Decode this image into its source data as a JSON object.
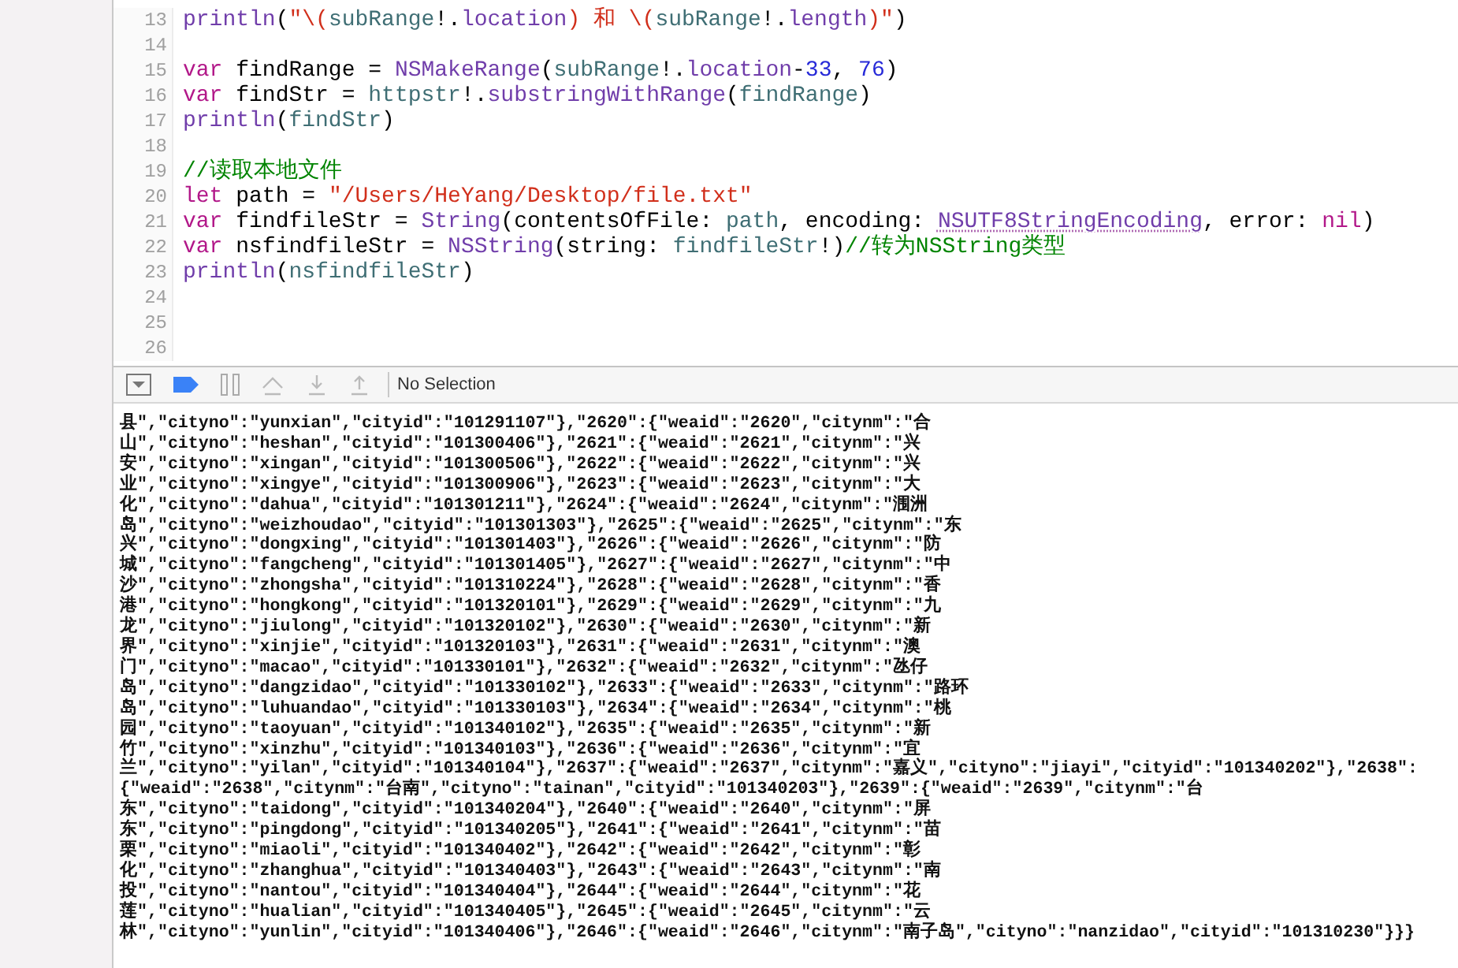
{
  "editor": {
    "lines": [
      {
        "number": "13",
        "tokens": [
          {
            "text": "println",
            "kind": "type"
          },
          {
            "text": "(",
            "kind": "plain"
          },
          {
            "text": "\"\\(",
            "kind": "string"
          },
          {
            "text": "subRange",
            "kind": "variable"
          },
          {
            "text": "!.",
            "kind": "plain"
          },
          {
            "text": "location",
            "kind": "type"
          },
          {
            "text": ") 和 \\(",
            "kind": "string"
          },
          {
            "text": "subRange",
            "kind": "variable"
          },
          {
            "text": "!.",
            "kind": "plain"
          },
          {
            "text": "length",
            "kind": "type"
          },
          {
            "text": ")\"",
            "kind": "string"
          },
          {
            "text": ")",
            "kind": "plain"
          }
        ]
      },
      {
        "number": "14"
      },
      {
        "number": "15",
        "tokens": [
          {
            "text": "var",
            "kind": "keyword"
          },
          {
            "text": " findRange = ",
            "kind": "plain"
          },
          {
            "text": "NSMakeRange",
            "kind": "type"
          },
          {
            "text": "(",
            "kind": "plain"
          },
          {
            "text": "subRange",
            "kind": "variable"
          },
          {
            "text": "!.",
            "kind": "plain"
          },
          {
            "text": "location",
            "kind": "type"
          },
          {
            "text": "-",
            "kind": "plain"
          },
          {
            "text": "33",
            "kind": "number"
          },
          {
            "text": ", ",
            "kind": "plain"
          },
          {
            "text": "76",
            "kind": "number"
          },
          {
            "text": ")",
            "kind": "plain"
          }
        ]
      },
      {
        "number": "16",
        "tokens": [
          {
            "text": "var",
            "kind": "keyword"
          },
          {
            "text": " findStr = ",
            "kind": "plain"
          },
          {
            "text": "httpstr",
            "kind": "variable"
          },
          {
            "text": "!.",
            "kind": "plain"
          },
          {
            "text": "substringWithRange",
            "kind": "type"
          },
          {
            "text": "(",
            "kind": "plain"
          },
          {
            "text": "findRange",
            "kind": "variable"
          },
          {
            "text": ")",
            "kind": "plain"
          }
        ]
      },
      {
        "number": "17",
        "tokens": [
          {
            "text": "println",
            "kind": "type"
          },
          {
            "text": "(",
            "kind": "plain"
          },
          {
            "text": "findStr",
            "kind": "variable"
          },
          {
            "text": ")",
            "kind": "plain"
          }
        ]
      },
      {
        "number": "18"
      },
      {
        "number": "19",
        "tokens": [
          {
            "text": "//读取本地文件",
            "kind": "comment"
          }
        ]
      },
      {
        "number": "20",
        "tokens": [
          {
            "text": "let",
            "kind": "keyword"
          },
          {
            "text": " path = ",
            "kind": "plain"
          },
          {
            "text": "\"/Users/HeYang/Desktop/file.txt\"",
            "kind": "string"
          }
        ]
      },
      {
        "number": "21",
        "tokens": [
          {
            "text": "var",
            "kind": "keyword"
          },
          {
            "text": " findfileStr = ",
            "kind": "plain"
          },
          {
            "text": "String",
            "kind": "type"
          },
          {
            "text": "(contentsOfFile: ",
            "kind": "plain"
          },
          {
            "text": "path",
            "kind": "variable"
          },
          {
            "text": ", encoding: ",
            "kind": "plain"
          },
          {
            "text": "NSUTF8StringEncoding",
            "kind": "flagged"
          },
          {
            "text": ", error: ",
            "kind": "plain"
          },
          {
            "text": "nil",
            "kind": "keyword"
          },
          {
            "text": ")",
            "kind": "plain"
          }
        ]
      },
      {
        "number": "22",
        "tokens": [
          {
            "text": "var",
            "kind": "keyword"
          },
          {
            "text": " nsfindfileStr = ",
            "kind": "plain"
          },
          {
            "text": "NSString",
            "kind": "type"
          },
          {
            "text": "(string: ",
            "kind": "plain"
          },
          {
            "text": "findfileStr",
            "kind": "variable"
          },
          {
            "text": "!)",
            "kind": "plain"
          },
          {
            "text": "//转为NSString类型",
            "kind": "comment"
          }
        ]
      },
      {
        "number": "23",
        "tokens": [
          {
            "text": "println",
            "kind": "type"
          },
          {
            "text": "(",
            "kind": "plain"
          },
          {
            "text": "nsfindfileStr",
            "kind": "variable"
          },
          {
            "text": ")",
            "kind": "plain"
          }
        ]
      },
      {
        "number": "24"
      },
      {
        "number": "25"
      },
      {
        "number": "26"
      }
    ]
  },
  "debug_bar": {
    "breakpoints_active": true,
    "selection_label": "No Selection"
  },
  "console": {
    "lines": [
      "县\",\"cityno\":\"yunxian\",\"cityid\":\"101291107\"},\"2620\":{\"weaid\":\"2620\",\"citynm\":\"合",
      "山\",\"cityno\":\"heshan\",\"cityid\":\"101300406\"},\"2621\":{\"weaid\":\"2621\",\"citynm\":\"兴",
      "安\",\"cityno\":\"xingan\",\"cityid\":\"101300506\"},\"2622\":{\"weaid\":\"2622\",\"citynm\":\"兴",
      "业\",\"cityno\":\"xingye\",\"cityid\":\"101300906\"},\"2623\":{\"weaid\":\"2623\",\"citynm\":\"大",
      "化\",\"cityno\":\"dahua\",\"cityid\":\"101301211\"},\"2624\":{\"weaid\":\"2624\",\"citynm\":\"涠洲",
      "岛\",\"cityno\":\"weizhoudao\",\"cityid\":\"101301303\"},\"2625\":{\"weaid\":\"2625\",\"citynm\":\"东",
      "兴\",\"cityno\":\"dongxing\",\"cityid\":\"101301403\"},\"2626\":{\"weaid\":\"2626\",\"citynm\":\"防",
      "城\",\"cityno\":\"fangcheng\",\"cityid\":\"101301405\"},\"2627\":{\"weaid\":\"2627\",\"citynm\":\"中",
      "沙\",\"cityno\":\"zhongsha\",\"cityid\":\"101310224\"},\"2628\":{\"weaid\":\"2628\",\"citynm\":\"香",
      "港\",\"cityno\":\"hongkong\",\"cityid\":\"101320101\"},\"2629\":{\"weaid\":\"2629\",\"citynm\":\"九",
      "龙\",\"cityno\":\"jiulong\",\"cityid\":\"101320102\"},\"2630\":{\"weaid\":\"2630\",\"citynm\":\"新",
      "界\",\"cityno\":\"xinjie\",\"cityid\":\"101320103\"},\"2631\":{\"weaid\":\"2631\",\"citynm\":\"澳",
      "门\",\"cityno\":\"macao\",\"cityid\":\"101330101\"},\"2632\":{\"weaid\":\"2632\",\"citynm\":\"氹仔",
      "岛\",\"cityno\":\"dangzidao\",\"cityid\":\"101330102\"},\"2633\":{\"weaid\":\"2633\",\"citynm\":\"路环",
      "岛\",\"cityno\":\"luhuandao\",\"cityid\":\"101330103\"},\"2634\":{\"weaid\":\"2634\",\"citynm\":\"桃",
      "园\",\"cityno\":\"taoyuan\",\"cityid\":\"101340102\"},\"2635\":{\"weaid\":\"2635\",\"citynm\":\"新",
      "竹\",\"cityno\":\"xinzhu\",\"cityid\":\"101340103\"},\"2636\":{\"weaid\":\"2636\",\"citynm\":\"宜",
      "兰\",\"cityno\":\"yilan\",\"cityid\":\"101340104\"},\"2637\":{\"weaid\":\"2637\",\"citynm\":\"嘉义\",\"cityno\":\"jiayi\",\"cityid\":\"101340202\"},\"2638\":",
      "{\"weaid\":\"2638\",\"citynm\":\"台南\",\"cityno\":\"tainan\",\"cityid\":\"101340203\"},\"2639\":{\"weaid\":\"2639\",\"citynm\":\"台",
      "东\",\"cityno\":\"taidong\",\"cityid\":\"101340204\"},\"2640\":{\"weaid\":\"2640\",\"citynm\":\"屏",
      "东\",\"cityno\":\"pingdong\",\"cityid\":\"101340205\"},\"2641\":{\"weaid\":\"2641\",\"citynm\":\"苗",
      "栗\",\"cityno\":\"miaoli\",\"cityid\":\"101340402\"},\"2642\":{\"weaid\":\"2642\",\"citynm\":\"彰",
      "化\",\"cityno\":\"zhanghua\",\"cityid\":\"101340403\"},\"2643\":{\"weaid\":\"2643\",\"citynm\":\"南",
      "投\",\"cityno\":\"nantou\",\"cityid\":\"101340404\"},\"2644\":{\"weaid\":\"2644\",\"citynm\":\"花",
      "莲\",\"cityno\":\"hualian\",\"cityid\":\"101340405\"},\"2645\":{\"weaid\":\"2645\",\"citynm\":\"云",
      "林\",\"cityno\":\"yunlin\",\"cityid\":\"101340406\"},\"2646\":{\"weaid\":\"2646\",\"citynm\":\"南子岛\",\"cityno\":\"nanzidao\",\"cityid\":\"101310230\"}}}"
    ]
  }
}
